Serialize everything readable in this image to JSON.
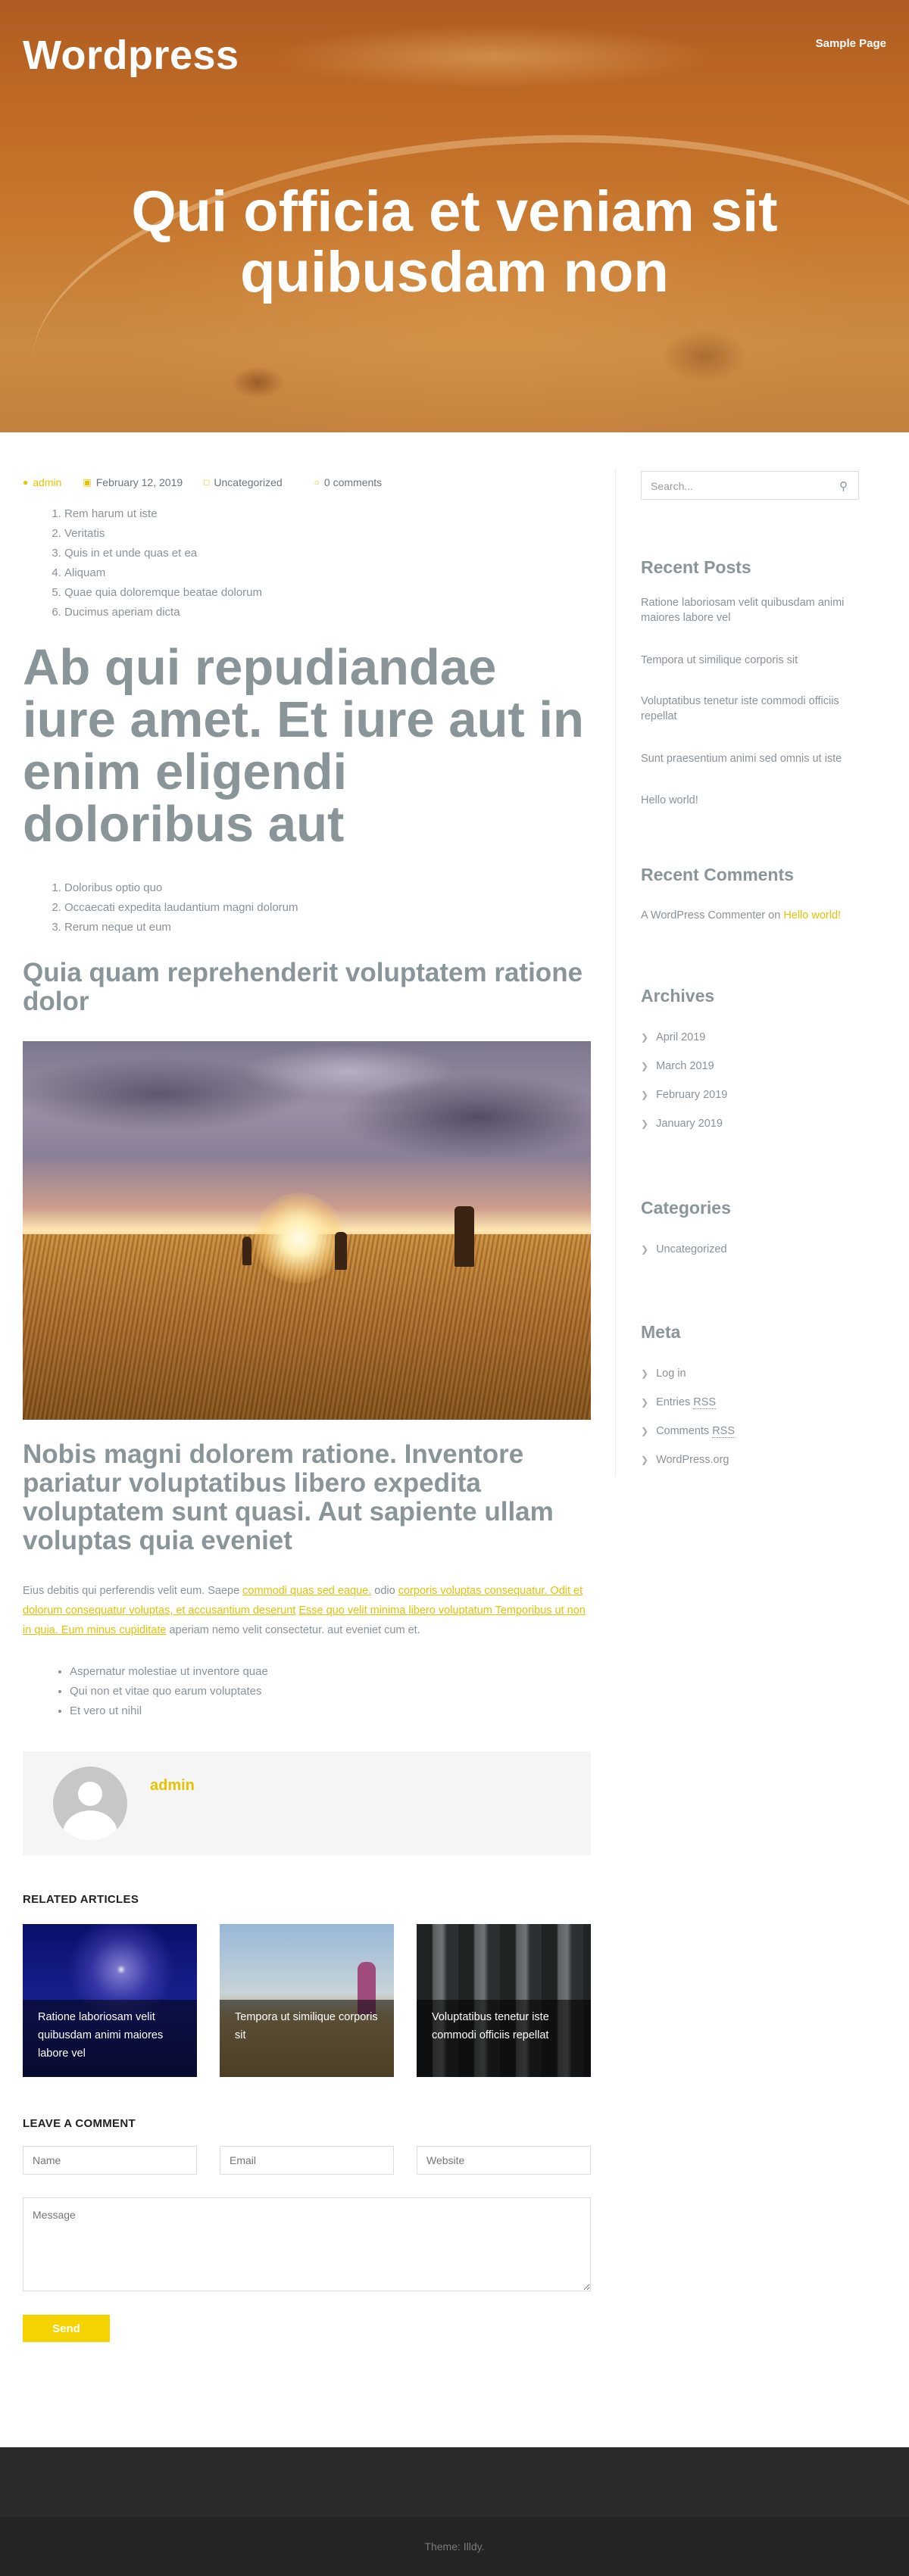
{
  "site": {
    "title": "Wordpress",
    "nav_link": "Sample Page"
  },
  "hero": {
    "title": "Qui officia et veniam sit quibusdam non"
  },
  "meta": {
    "author": "admin",
    "date": "February 12, 2019",
    "category": "Uncategorized",
    "comments": "0 comments"
  },
  "content": {
    "list1": [
      "Rem harum ut iste",
      "Veritatis",
      "Quis in et unde quas et ea",
      "Aliquam",
      "Quae quia doloremque beatae dolorum",
      "Ducimus aperiam dicta"
    ],
    "heading1": "Ab qui repudiandae iure amet. Et iure aut in enim eligendi doloribus aut",
    "list2": [
      "Doloribus optio quo",
      "Occaecati expedita laudantium magni dolorum",
      "Rerum neque ut eum"
    ],
    "heading2": "Quia quam reprehenderit voluptatem ratione dolor",
    "heading3": "Nobis magni dolorem ratione. Inventore pariatur voluptatibus libero expedita voluptatem sunt quasi. Aut sapiente ullam voluptas quia eveniet",
    "paragraph": {
      "t1": "Eius debitis qui perferendis velit eum. Saepe ",
      "l1": "commodi quas sed eaque.",
      "t2": " odio ",
      "l2": "corporis voluptas consequatur. Odit et dolorum consequatur voluptas, et accusantium deserunt",
      "t3": " ",
      "l3": "Esse quo velit minima libero voluptatum Temporibus ut non in quia. Eum minus cupiditate",
      "t4": " aperiam nemo velit consectetur. aut eveniet cum et."
    },
    "bullets": [
      "Aspernatur molestiae ut inventore quae",
      "Qui non et vitae quo earum voluptates",
      "Et vero ut nihil"
    ]
  },
  "author_box": {
    "name": "admin"
  },
  "related": {
    "heading": "RELATED ARTICLES",
    "items": [
      {
        "title": "Ratione laboriosam velit quibusdam animi maiores labore vel"
      },
      {
        "title": "Tempora ut similique corporis sit"
      },
      {
        "title": "Voluptatibus tenetur iste commodi officiis repellat"
      }
    ]
  },
  "comment_form": {
    "heading": "LEAVE A COMMENT",
    "name_placeholder": "Name",
    "email_placeholder": "Email",
    "website_placeholder": "Website",
    "message_placeholder": "Message",
    "send_label": "Send"
  },
  "sidebar": {
    "search_placeholder": "Search...",
    "recent_posts": {
      "title": "Recent Posts",
      "items": [
        "Ratione laboriosam velit quibusdam animi maiores labore vel",
        "Tempora ut similique corporis sit",
        "Voluptatibus tenetur iste commodi officiis repellat",
        "Sunt praesentium animi sed omnis ut iste",
        "Hello world!"
      ]
    },
    "recent_comments": {
      "title": "Recent Comments",
      "author": "A WordPress Commenter",
      "on": " on ",
      "post": "Hello world!"
    },
    "archives": {
      "title": "Archives",
      "items": [
        "April 2019",
        "March 2019",
        "February 2019",
        "January 2019"
      ]
    },
    "categories": {
      "title": "Categories",
      "items": [
        "Uncategorized"
      ]
    },
    "meta": {
      "title": "Meta",
      "login": "Log in",
      "entries_prefix": "Entries ",
      "comments_prefix": "Comments ",
      "rss": "RSS",
      "wordpress_org": "WordPress.org"
    }
  },
  "footer": {
    "text": "Theme: Illdy."
  },
  "colors": {
    "accent": "#e6c200",
    "button": "#f5d300",
    "hero": "#c0702a",
    "footer": "#2b2b2b"
  },
  "icons": [
    "user-icon",
    "calendar-icon",
    "folder-icon",
    "comment-icon",
    "search-icon",
    "chevron-right-icon"
  ]
}
